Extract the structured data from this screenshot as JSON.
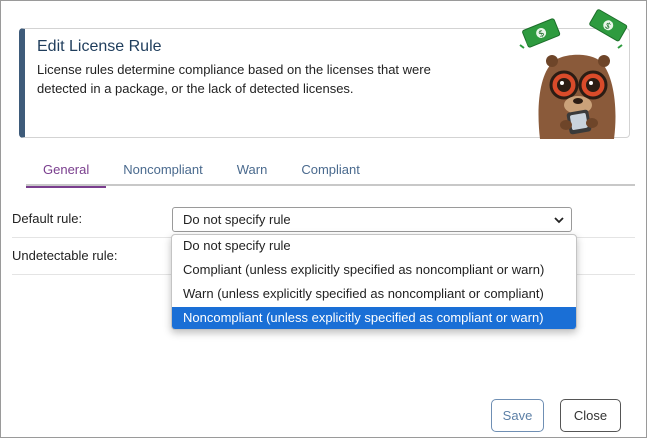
{
  "header": {
    "title": "Edit License Rule",
    "description": "License rules determine compliance based on the licenses that were detected in a package, or the lack of detected licenses."
  },
  "tabs": [
    {
      "label": "General",
      "active": true
    },
    {
      "label": "Noncompliant",
      "active": false
    },
    {
      "label": "Warn",
      "active": false
    },
    {
      "label": "Compliant",
      "active": false
    }
  ],
  "form": {
    "default_rule_label": "Default rule:",
    "default_rule_value": "Do not specify rule",
    "undetectable_rule_label": "Undetectable rule:"
  },
  "dropdown": {
    "options": [
      "Do not specify rule",
      "Compliant (unless explicitly specified as noncompliant or warn)",
      "Warn (unless explicitly specified as noncompliant or compliant)",
      "Noncompliant (unless explicitly specified as compliant or warn)"
    ],
    "highlighted_index": 3
  },
  "buttons": {
    "save": "Save",
    "close": "Close"
  },
  "icons": {
    "mascot": "otter-mascot-icon",
    "money": "money-bill-icon",
    "chevron": "chevron-down-icon"
  },
  "colors": {
    "accent": "#7a3e8e",
    "header_border": "#3e5b7a",
    "highlight": "#1a6fd6",
    "tab_text": "#4a6a8e"
  }
}
